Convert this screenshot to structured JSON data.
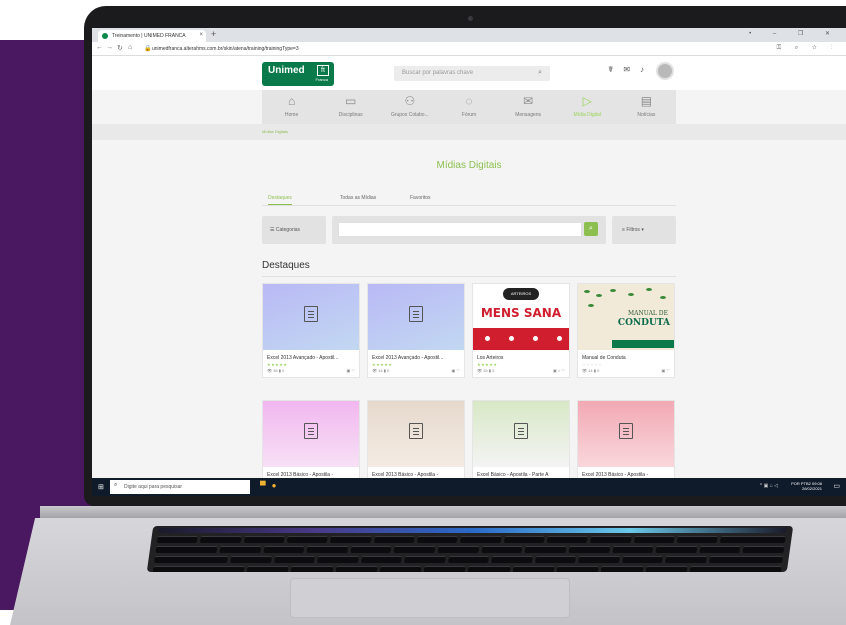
{
  "browser": {
    "tab_title": "Treinamento | UNIMED FRANCA",
    "tab_close": "×",
    "new_tab": "+",
    "window_controls": "• – ❐ ✕",
    "url": "unimedfranca.alterahms.com.br/skin/atena/training/trainingType=3"
  },
  "site": {
    "logo_main": "Unimed",
    "logo_sub": "Franca",
    "search_placeholder": "Buscar por palavras chave",
    "menu": [
      {
        "label": "Home",
        "icon": "⌂"
      },
      {
        "label": "Disciplinas",
        "icon": "▭"
      },
      {
        "label": "Grupos Colabo...",
        "icon": "⚇"
      },
      {
        "label": "Fórum",
        "icon": "◌"
      },
      {
        "label": "Mensagens",
        "icon": "✉"
      },
      {
        "label": "Mídia Digital",
        "icon": "▷"
      },
      {
        "label": "Notícias",
        "icon": "▤"
      }
    ],
    "breadcrumb": "Mídias Digitais",
    "page_title": "Mídias Digitais",
    "subtabs": [
      "Destaques",
      "Todas as Mídias",
      "Favoritos"
    ],
    "categories_label": "Categorias",
    "filters_label": "Filtros",
    "section_title": "Destaques",
    "cards": [
      {
        "title": "Excel 2013 Avançado - Apostil...",
        "meta": "👁 39  ▮ 0",
        "stars": "★★★★★"
      },
      {
        "title": "Excel 2013 Avançado - Apostil...",
        "meta": "👁 14  ▮ 0",
        "stars": "★★★★★"
      },
      {
        "title": "Los Arteiros",
        "meta": "👁 33  ▮ 3",
        "stars": "★★★★★",
        "cover_top": "ARTEIROS",
        "cover_word": "MENS SANA"
      },
      {
        "title": "Manual de Conduta",
        "meta": "👁 14  ▮ 0",
        "stars": "☆☆☆☆☆",
        "cover_line1": "MANUAL DE",
        "cover_line2": "CONDUTA"
      },
      {
        "title": "Excel 2013 Básico - Apostila -"
      },
      {
        "title": "Excel 2013 Básico - Apostila -"
      },
      {
        "title": "Excel Básico - Apostila - Parte A"
      },
      {
        "title": "Excel 2013 Básico - Apostila -"
      }
    ]
  },
  "taskbar": {
    "search_placeholder": "Digite aqui para pesquisar",
    "tray_lang": "POR PTB2",
    "tray_time": "09:08",
    "tray_date": "26/02/2021"
  },
  "colors": {
    "brand_green": "#0a7a4a",
    "accent_lime": "#8cbf50",
    "background_purple": "#4a1860"
  }
}
